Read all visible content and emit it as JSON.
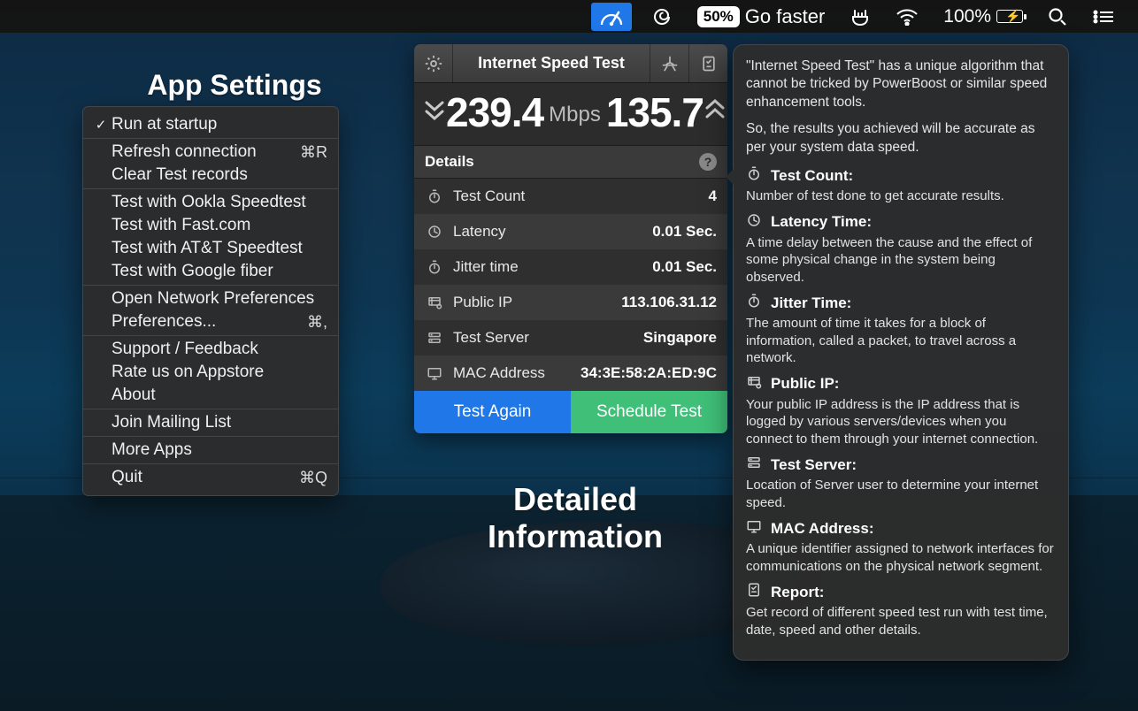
{
  "menubar": {
    "badge": "50%",
    "go_faster": "Go faster",
    "battery_pct": "100%"
  },
  "headings": {
    "app_settings": "App Settings",
    "detailed_info": "Detailed Information"
  },
  "context_menu": {
    "groups": [
      [
        {
          "label": "Run at startup",
          "checked": true
        }
      ],
      [
        {
          "label": "Refresh connection",
          "shortcut": "⌘R"
        },
        {
          "label": "Clear Test records"
        }
      ],
      [
        {
          "label": "Test with Ookla Speedtest"
        },
        {
          "label": "Test with Fast.com"
        },
        {
          "label": "Test with AT&T Speedtest"
        },
        {
          "label": "Test with Google fiber"
        }
      ],
      [
        {
          "label": "Open Network Preferences"
        },
        {
          "label": "Preferences...",
          "shortcut": "⌘,"
        }
      ],
      [
        {
          "label": "Support / Feedback"
        },
        {
          "label": "Rate us on Appstore"
        },
        {
          "label": "About"
        }
      ],
      [
        {
          "label": "Join Mailing List"
        }
      ],
      [
        {
          "label": "More Apps"
        }
      ],
      [
        {
          "label": "Quit",
          "shortcut": "⌘Q"
        }
      ]
    ]
  },
  "panel": {
    "title": "Internet Speed Test",
    "download": "239.4",
    "upload": "135.7",
    "unit": "Mbps",
    "details_label": "Details",
    "rows": [
      {
        "icon": "stopwatch",
        "key": "Test Count",
        "value": "4"
      },
      {
        "icon": "latency",
        "key": "Latency",
        "value": "0.01 Sec."
      },
      {
        "icon": "stopwatch",
        "key": "Jitter time",
        "value": "0.01 Sec."
      },
      {
        "icon": "globe",
        "key": "Public IP",
        "value": "113.106.31.12"
      },
      {
        "icon": "server",
        "key": "Test Server",
        "value": "Singapore"
      },
      {
        "icon": "monitor",
        "key": "MAC Address",
        "value": "34:3E:58:2A:ED:9C"
      }
    ],
    "test_again": "Test Again",
    "schedule": "Schedule Test"
  },
  "popover": {
    "intro1": "\"Internet Speed Test\" has a unique algorithm that cannot be tricked by PowerBoost or similar speed enhancement tools.",
    "intro2": "So, the results you achieved will be accurate as per your system data speed.",
    "sections": [
      {
        "icon": "stopwatch",
        "title": "Test Count:",
        "desc": "Number of test done to get accurate results."
      },
      {
        "icon": "latency",
        "title": "Latency Time:",
        "desc": "A time delay between the cause and the effect of some physical change in the system being observed."
      },
      {
        "icon": "stopwatch",
        "title": "Jitter Time:",
        "desc": "The amount of time it takes for a block of information, called a packet, to travel across a network."
      },
      {
        "icon": "globe",
        "title": "Public IP:",
        "desc": "Your public IP address is the IP address that is logged by various servers/devices when you connect to them through your internet connection."
      },
      {
        "icon": "server",
        "title": "Test Server:",
        "desc": "Location of Server user to determine your internet speed."
      },
      {
        "icon": "monitor",
        "title": "MAC Address:",
        "desc": "A unique identifier assigned to network interfaces for communications on the physical network segment."
      },
      {
        "icon": "report",
        "title": "Report:",
        "desc": "Get record of different speed test run with test time, date, speed and other details."
      }
    ]
  }
}
